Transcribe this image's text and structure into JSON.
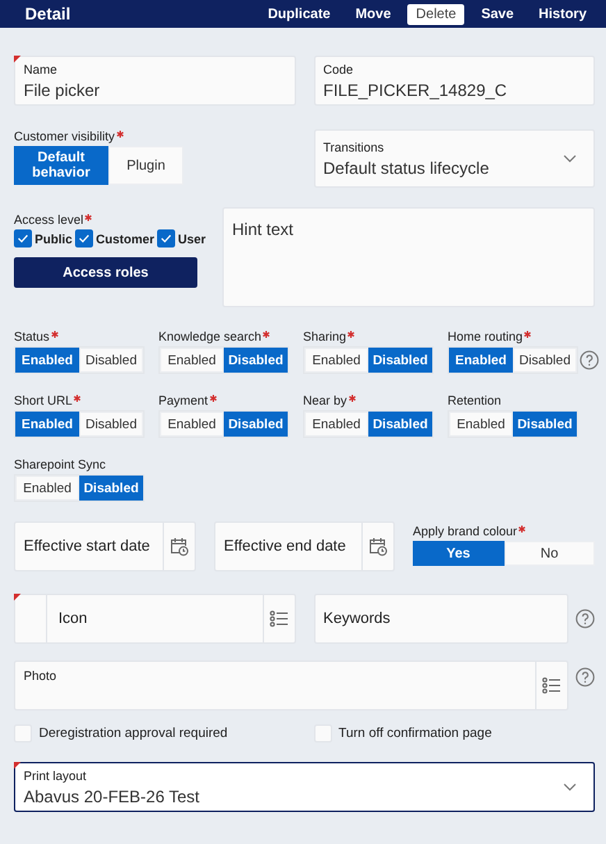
{
  "header": {
    "title": "Detail",
    "actions": [
      {
        "label": "Duplicate",
        "kind": "text"
      },
      {
        "label": "Move",
        "kind": "text"
      },
      {
        "label": "Delete",
        "kind": "outline"
      },
      {
        "label": "Save",
        "kind": "text"
      },
      {
        "label": "History",
        "kind": "text"
      }
    ]
  },
  "name": {
    "label": "Name",
    "value": "File picker",
    "marked": true
  },
  "code": {
    "label": "Code",
    "value": "FILE_PICKER_14829_C",
    "marked": false
  },
  "customer_visibility": {
    "label": "Customer visibility",
    "required": true,
    "options": [
      {
        "label": "Default behavior",
        "selected": true
      },
      {
        "label": "Plugin",
        "selected": false
      }
    ]
  },
  "transitions": {
    "label": "Transitions",
    "value": "Default status lifecycle"
  },
  "access_level": {
    "label": "Access level",
    "required": true,
    "options": [
      {
        "label": "Public",
        "checked": true
      },
      {
        "label": "Customer",
        "checked": true
      },
      {
        "label": "User",
        "checked": true
      }
    ]
  },
  "access_roles_button": "Access roles",
  "hint": {
    "placeholder": "Hint text"
  },
  "toggles": [
    {
      "label": "Status",
      "required": true,
      "help": false,
      "options": [
        {
          "label": "Enabled",
          "selected": true
        },
        {
          "label": "Disabled",
          "selected": false
        }
      ]
    },
    {
      "label": "Knowledge search",
      "required": true,
      "help": false,
      "options": [
        {
          "label": "Enabled",
          "selected": false
        },
        {
          "label": "Disabled",
          "selected": true
        }
      ]
    },
    {
      "label": "Sharing",
      "required": true,
      "help": false,
      "options": [
        {
          "label": "Enabled",
          "selected": false
        },
        {
          "label": "Disabled",
          "selected": true
        }
      ]
    },
    {
      "label": "Home routing",
      "required": true,
      "help": true,
      "options": [
        {
          "label": "Enabled",
          "selected": true
        },
        {
          "label": "Disabled",
          "selected": false
        }
      ]
    },
    {
      "label": "Short URL",
      "required": true,
      "help": false,
      "options": [
        {
          "label": "Enabled",
          "selected": true
        },
        {
          "label": "Disabled",
          "selected": false
        }
      ]
    },
    {
      "label": "Payment",
      "required": true,
      "help": false,
      "options": [
        {
          "label": "Enabled",
          "selected": false
        },
        {
          "label": "Disabled",
          "selected": true
        }
      ]
    },
    {
      "label": "Near by",
      "required": true,
      "help": false,
      "options": [
        {
          "label": "Enabled",
          "selected": false
        },
        {
          "label": "Disabled",
          "selected": true
        }
      ]
    },
    {
      "label": "Retention",
      "required": false,
      "help": false,
      "options": [
        {
          "label": "Enabled",
          "selected": false
        },
        {
          "label": "Disabled",
          "selected": true
        }
      ]
    },
    {
      "label": "Sharepoint Sync",
      "required": false,
      "help": false,
      "options": [
        {
          "label": "Enabled",
          "selected": false
        },
        {
          "label": "Disabled",
          "selected": true
        }
      ]
    }
  ],
  "dates": [
    {
      "placeholder": "Effective start date"
    },
    {
      "placeholder": "Effective end date"
    }
  ],
  "brand_colour": {
    "label": "Apply brand colour",
    "required": true,
    "options": [
      {
        "label": "Yes",
        "selected": true
      },
      {
        "label": "No",
        "selected": false
      }
    ]
  },
  "icon_field": {
    "placeholder": "Icon",
    "marked": true
  },
  "keywords": {
    "placeholder": "Keywords",
    "help": true
  },
  "photo": {
    "label": "Photo",
    "help": true
  },
  "checkboxes": [
    {
      "label": "Deregistration approval required",
      "checked": false
    },
    {
      "label": "Turn off confirmation page",
      "checked": false
    }
  ],
  "print_layout": {
    "label": "Print layout",
    "value": "Abavus 20-FEB-26 Test",
    "marked": true,
    "focused": true
  }
}
